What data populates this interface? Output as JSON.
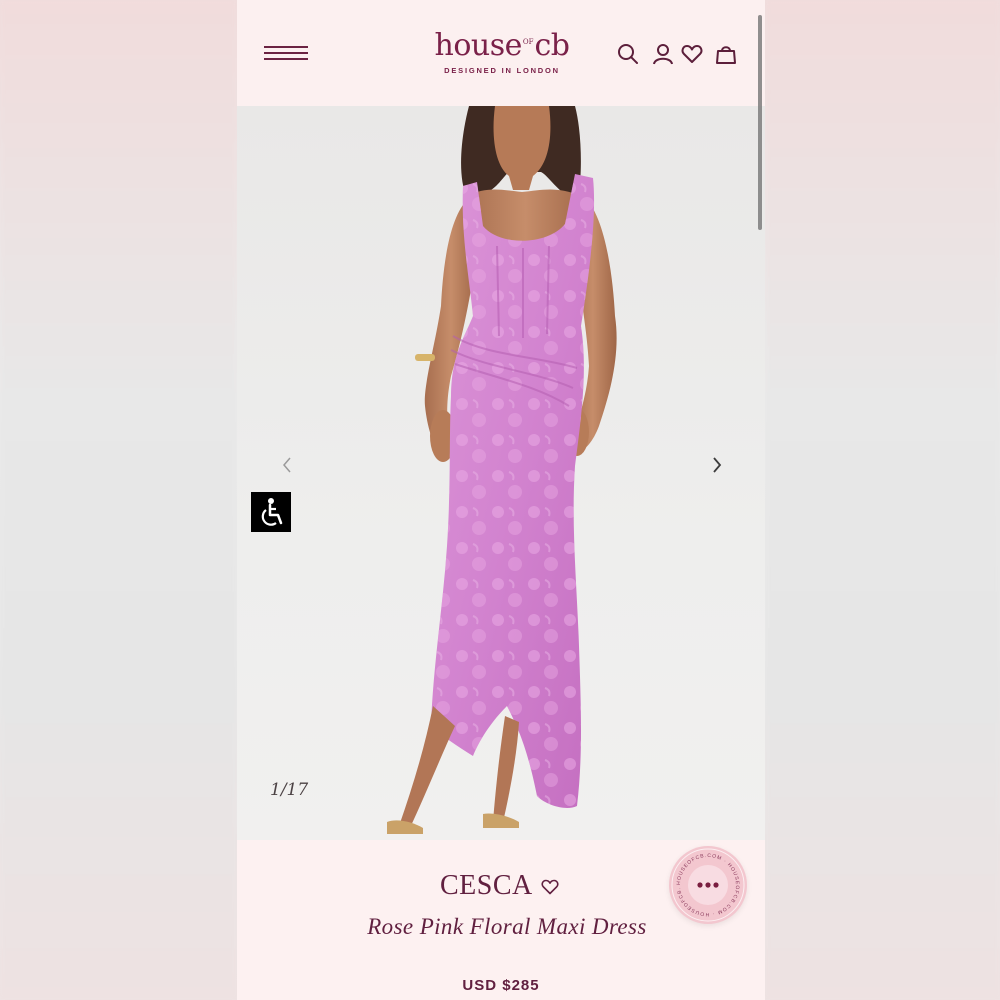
{
  "brand": {
    "logo_main": "house",
    "logo_of": "OF",
    "logo_cb": "cb",
    "tagline": "DESIGNED IN LONDON",
    "color": "#7a2149"
  },
  "header": {
    "icons": [
      "menu-icon",
      "search-icon",
      "account-icon",
      "wishlist-icon",
      "bag-icon"
    ]
  },
  "gallery": {
    "counter": "1/17",
    "dress_color": "#d68bd3"
  },
  "product": {
    "name": "CESCA",
    "subtitle": "Rose Pink Floral Maxi Dress",
    "price": "USD $285"
  },
  "chat_badge": {
    "ring_text": "HOUSEOFCB.COM · HOUSEOFCB.COM · HOUSEOFCB.COM ·"
  }
}
